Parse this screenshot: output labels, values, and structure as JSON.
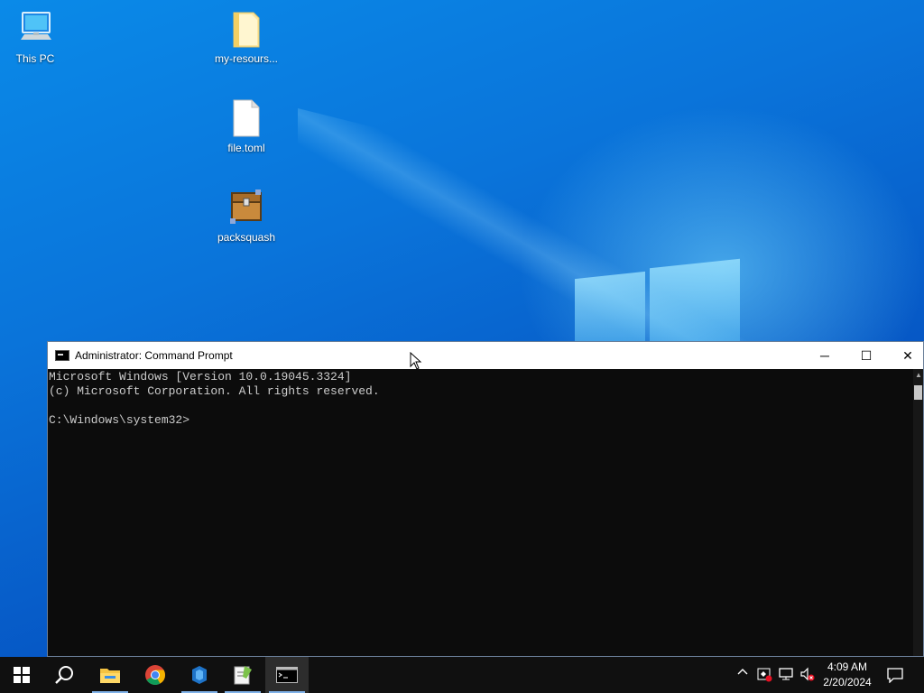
{
  "desktop": {
    "icons": [
      {
        "label": "This PC"
      },
      {
        "label": "my-resours..."
      },
      {
        "label": "file.toml"
      },
      {
        "label": "packsquash"
      }
    ]
  },
  "cmd_window": {
    "title": "Administrator: Command Prompt",
    "controls": {
      "minimize": "─",
      "maximize": "☐",
      "close": "✕"
    },
    "console_lines": [
      "Microsoft Windows [Version 10.0.19045.3324]",
      "(c) Microsoft Corporation. All rights reserved.",
      "",
      "C:\\Windows\\system32>"
    ]
  },
  "taskbar": {
    "pinned": [
      "start-icon",
      "search-icon",
      "file-explorer-icon",
      "chrome-icon",
      "app-icon",
      "notepad-plus-icon",
      "command-prompt-icon"
    ],
    "clock": {
      "time": "4:09 AM",
      "date": "2/20/2024"
    }
  },
  "colors": {
    "console_bg": "#0c0c0c",
    "console_text": "#cccccc",
    "taskbar": "#101010"
  }
}
